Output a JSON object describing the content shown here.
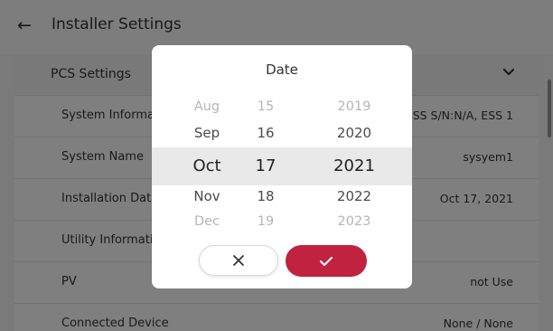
{
  "header": {
    "title": "Installer Settings",
    "back_icon": "back-arrow-icon"
  },
  "section": {
    "label": "PCS Settings",
    "chevron_icon": "chevron-down-icon"
  },
  "rows": [
    {
      "label": "System Information",
      "value": "ESS S/N:N/A, ESS 1"
    },
    {
      "label": "System Name",
      "value": "sysyem1"
    },
    {
      "label": "Installation Date",
      "value": "Oct 17, 2021"
    },
    {
      "label": "Utility Information",
      "value": ""
    },
    {
      "label": "PV",
      "value": "not Use"
    },
    {
      "label": "Connected Device",
      "value": "None / None"
    }
  ],
  "dialog": {
    "title": "Date",
    "months": [
      "Aug",
      "Sep",
      "Oct",
      "Nov",
      "Dec"
    ],
    "days": [
      "15",
      "16",
      "17",
      "18",
      "19"
    ],
    "years": [
      "2019",
      "2020",
      "2021",
      "2022",
      "2023"
    ],
    "selected": {
      "month": "Oct",
      "day": "17",
      "year": "2021"
    },
    "cancel_icon": "close-icon",
    "confirm_icon": "check-icon"
  },
  "colors": {
    "accent": "#c0223f",
    "selection_band": "#e9e9e9",
    "overlay": "rgba(0,0,0,0.5)"
  }
}
